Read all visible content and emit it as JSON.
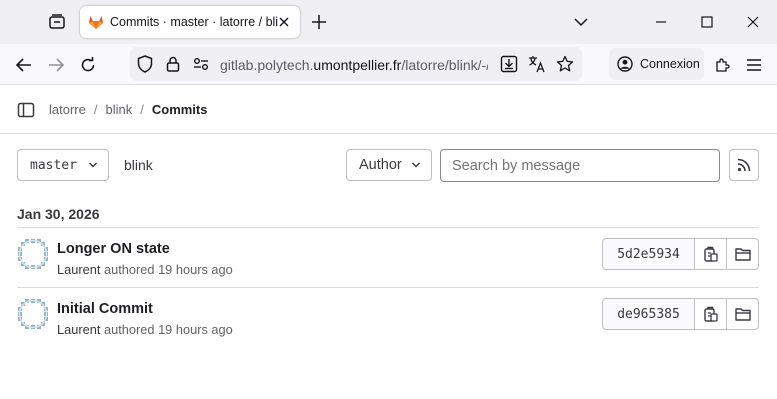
{
  "browser": {
    "tab_title": "Commits · master · latorre / blink · GitLab",
    "url_prefix": "gitlab.polytech.",
    "url_domain": "umontpellier.fr",
    "url_path": "/latorre/blink/-/commits/master",
    "signin_label": "Connexion"
  },
  "breadcrumb": {
    "items": [
      "latorre",
      "blink"
    ],
    "current": "Commits"
  },
  "filters": {
    "branch": "master",
    "path": "blink",
    "author_label": "Author",
    "search_placeholder": "Search by message"
  },
  "date_header": "Jan 30, 2026",
  "commits": [
    {
      "title": "Longer ON state",
      "author": "Laurent",
      "action": "authored",
      "time": "19 hours ago",
      "sha": "5d2e5934"
    },
    {
      "title": "Initial Commit",
      "author": "Laurent",
      "action": "authored",
      "time": "19 hours ago",
      "sha": "de965385"
    }
  ],
  "colors": {
    "gitlab_orange": "#fc6d26",
    "avatar_teal": "#8fb3c2"
  },
  "icons": [
    "tab-manager-icon",
    "gitlab-logo-icon",
    "close-icon",
    "plus-icon",
    "chevron-down-icon",
    "minimize-icon",
    "maximize-icon",
    "back-icon",
    "forward-icon",
    "reload-icon",
    "shield-icon",
    "lock-icon",
    "site-info-icon",
    "download-icon",
    "translate-icon",
    "star-icon",
    "account-icon",
    "extensions-icon",
    "menu-icon",
    "sidebar-icon",
    "rss-icon",
    "copy-icon",
    "folder-icon"
  ]
}
